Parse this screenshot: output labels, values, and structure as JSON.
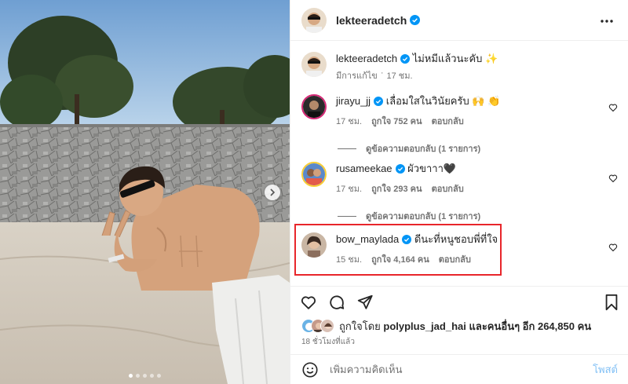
{
  "post": {
    "author": "lekteeradetch",
    "more_icon": "more-horizontal-icon",
    "caption_user": "lekteeradetch",
    "caption_text": "ไม่หมีแล้วนะคับ ✨",
    "caption_edited": "มีการแก้ไข",
    "caption_time": "17 ชม.",
    "carousel_index": 1,
    "carousel_total": 5
  },
  "comments": [
    {
      "user": "jirayu_jj",
      "text": "เลื่อมใสในวินัยครับ 🙌 👏",
      "time": "17 ชม.",
      "likes": "ถูกใจ 752 คน",
      "reply": "ตอบกลับ",
      "view_replies": "ดูข้อความตอบกลับ (1 รายการ)"
    },
    {
      "user": "rusameekae",
      "text": "ผัวขาาา🖤",
      "time": "17 ชม.",
      "likes": "ถูกใจ 293 คน",
      "reply": "ตอบกลับ",
      "view_replies": "ดูข้อความตอบกลับ (1 รายการ)"
    },
    {
      "user": "bow_maylada",
      "text": "ดีนะที่หนูชอบพี่ที่ใจ",
      "time": "15 ชม.",
      "likes": "ถูกใจ 4,164 คน",
      "reply": "ตอบกลับ"
    }
  ],
  "likes": {
    "prefix": "ถูกใจโดย",
    "user": "polyplus_jad_hai",
    "suffix": "และคนอื่นๆ อีก 264,850 คน"
  },
  "posted_ago": "18 ชั่วโมงที่แล้ว",
  "composer": {
    "emoji_icon": "smiley-icon",
    "placeholder": "เพิ่มความคิดเห็น",
    "post_label": "โพสต์"
  },
  "colors": {
    "verified": "#0095f6",
    "highlight": "#e8262b",
    "post_button": "#82c0f5",
    "secondary_text": "#737373"
  }
}
